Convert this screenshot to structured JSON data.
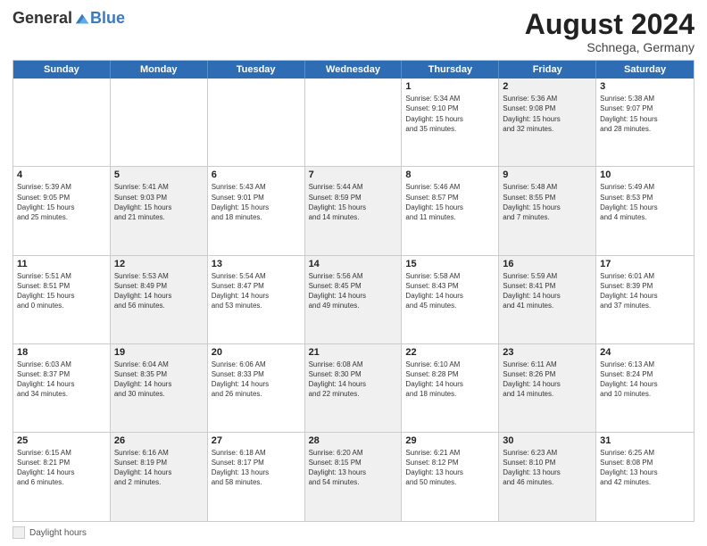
{
  "header": {
    "logo_general": "General",
    "logo_blue": "Blue",
    "month_year": "August 2024",
    "location": "Schnega, Germany"
  },
  "footer": {
    "label": "Daylight hours"
  },
  "days_of_week": [
    "Sunday",
    "Monday",
    "Tuesday",
    "Wednesday",
    "Thursday",
    "Friday",
    "Saturday"
  ],
  "weeks": [
    [
      {
        "num": "",
        "detail": "",
        "empty": true,
        "shaded": false
      },
      {
        "num": "",
        "detail": "",
        "empty": true,
        "shaded": false
      },
      {
        "num": "",
        "detail": "",
        "empty": true,
        "shaded": false
      },
      {
        "num": "",
        "detail": "",
        "empty": true,
        "shaded": false
      },
      {
        "num": "1",
        "detail": "Sunrise: 5:34 AM\nSunset: 9:10 PM\nDaylight: 15 hours\nand 35 minutes.",
        "shaded": false
      },
      {
        "num": "2",
        "detail": "Sunrise: 5:36 AM\nSunset: 9:08 PM\nDaylight: 15 hours\nand 32 minutes.",
        "shaded": true
      },
      {
        "num": "3",
        "detail": "Sunrise: 5:38 AM\nSunset: 9:07 PM\nDaylight: 15 hours\nand 28 minutes.",
        "shaded": false
      }
    ],
    [
      {
        "num": "4",
        "detail": "Sunrise: 5:39 AM\nSunset: 9:05 PM\nDaylight: 15 hours\nand 25 minutes.",
        "shaded": false
      },
      {
        "num": "5",
        "detail": "Sunrise: 5:41 AM\nSunset: 9:03 PM\nDaylight: 15 hours\nand 21 minutes.",
        "shaded": true
      },
      {
        "num": "6",
        "detail": "Sunrise: 5:43 AM\nSunset: 9:01 PM\nDaylight: 15 hours\nand 18 minutes.",
        "shaded": false
      },
      {
        "num": "7",
        "detail": "Sunrise: 5:44 AM\nSunset: 8:59 PM\nDaylight: 15 hours\nand 14 minutes.",
        "shaded": true
      },
      {
        "num": "8",
        "detail": "Sunrise: 5:46 AM\nSunset: 8:57 PM\nDaylight: 15 hours\nand 11 minutes.",
        "shaded": false
      },
      {
        "num": "9",
        "detail": "Sunrise: 5:48 AM\nSunset: 8:55 PM\nDaylight: 15 hours\nand 7 minutes.",
        "shaded": true
      },
      {
        "num": "10",
        "detail": "Sunrise: 5:49 AM\nSunset: 8:53 PM\nDaylight: 15 hours\nand 4 minutes.",
        "shaded": false
      }
    ],
    [
      {
        "num": "11",
        "detail": "Sunrise: 5:51 AM\nSunset: 8:51 PM\nDaylight: 15 hours\nand 0 minutes.",
        "shaded": false
      },
      {
        "num": "12",
        "detail": "Sunrise: 5:53 AM\nSunset: 8:49 PM\nDaylight: 14 hours\nand 56 minutes.",
        "shaded": true
      },
      {
        "num": "13",
        "detail": "Sunrise: 5:54 AM\nSunset: 8:47 PM\nDaylight: 14 hours\nand 53 minutes.",
        "shaded": false
      },
      {
        "num": "14",
        "detail": "Sunrise: 5:56 AM\nSunset: 8:45 PM\nDaylight: 14 hours\nand 49 minutes.",
        "shaded": true
      },
      {
        "num": "15",
        "detail": "Sunrise: 5:58 AM\nSunset: 8:43 PM\nDaylight: 14 hours\nand 45 minutes.",
        "shaded": false
      },
      {
        "num": "16",
        "detail": "Sunrise: 5:59 AM\nSunset: 8:41 PM\nDaylight: 14 hours\nand 41 minutes.",
        "shaded": true
      },
      {
        "num": "17",
        "detail": "Sunrise: 6:01 AM\nSunset: 8:39 PM\nDaylight: 14 hours\nand 37 minutes.",
        "shaded": false
      }
    ],
    [
      {
        "num": "18",
        "detail": "Sunrise: 6:03 AM\nSunset: 8:37 PM\nDaylight: 14 hours\nand 34 minutes.",
        "shaded": false
      },
      {
        "num": "19",
        "detail": "Sunrise: 6:04 AM\nSunset: 8:35 PM\nDaylight: 14 hours\nand 30 minutes.",
        "shaded": true
      },
      {
        "num": "20",
        "detail": "Sunrise: 6:06 AM\nSunset: 8:33 PM\nDaylight: 14 hours\nand 26 minutes.",
        "shaded": false
      },
      {
        "num": "21",
        "detail": "Sunrise: 6:08 AM\nSunset: 8:30 PM\nDaylight: 14 hours\nand 22 minutes.",
        "shaded": true
      },
      {
        "num": "22",
        "detail": "Sunrise: 6:10 AM\nSunset: 8:28 PM\nDaylight: 14 hours\nand 18 minutes.",
        "shaded": false
      },
      {
        "num": "23",
        "detail": "Sunrise: 6:11 AM\nSunset: 8:26 PM\nDaylight: 14 hours\nand 14 minutes.",
        "shaded": true
      },
      {
        "num": "24",
        "detail": "Sunrise: 6:13 AM\nSunset: 8:24 PM\nDaylight: 14 hours\nand 10 minutes.",
        "shaded": false
      }
    ],
    [
      {
        "num": "25",
        "detail": "Sunrise: 6:15 AM\nSunset: 8:21 PM\nDaylight: 14 hours\nand 6 minutes.",
        "shaded": false
      },
      {
        "num": "26",
        "detail": "Sunrise: 6:16 AM\nSunset: 8:19 PM\nDaylight: 14 hours\nand 2 minutes.",
        "shaded": true
      },
      {
        "num": "27",
        "detail": "Sunrise: 6:18 AM\nSunset: 8:17 PM\nDaylight: 13 hours\nand 58 minutes.",
        "shaded": false
      },
      {
        "num": "28",
        "detail": "Sunrise: 6:20 AM\nSunset: 8:15 PM\nDaylight: 13 hours\nand 54 minutes.",
        "shaded": true
      },
      {
        "num": "29",
        "detail": "Sunrise: 6:21 AM\nSunset: 8:12 PM\nDaylight: 13 hours\nand 50 minutes.",
        "shaded": false
      },
      {
        "num": "30",
        "detail": "Sunrise: 6:23 AM\nSunset: 8:10 PM\nDaylight: 13 hours\nand 46 minutes.",
        "shaded": true
      },
      {
        "num": "31",
        "detail": "Sunrise: 6:25 AM\nSunset: 8:08 PM\nDaylight: 13 hours\nand 42 minutes.",
        "shaded": false
      }
    ]
  ]
}
